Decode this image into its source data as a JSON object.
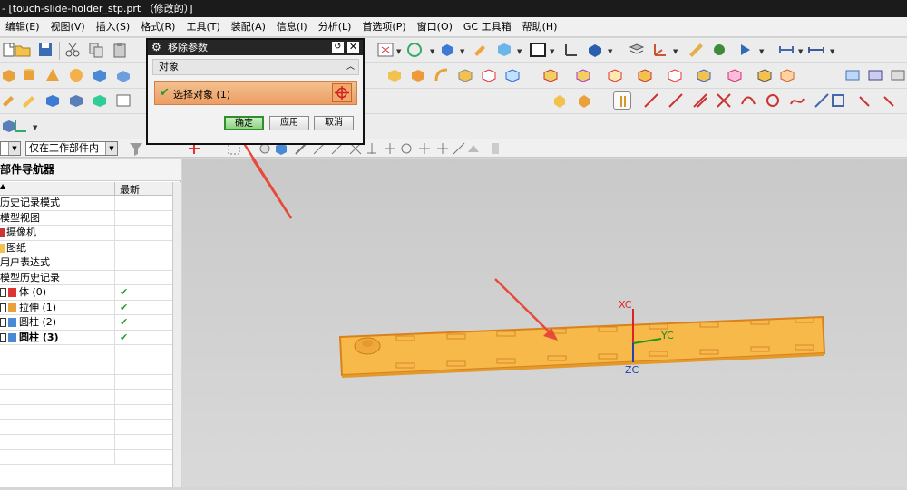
{
  "window": {
    "title": "- [touch-slide-holder_stp.prt （修改的）]"
  },
  "menu": [
    "编辑(E)",
    "视图(V)",
    "插入(S)",
    "格式(R)",
    "工具(T)",
    "装配(A)",
    "信息(I)",
    "分析(L)",
    "首选项(P)",
    "窗口(O)",
    "GC 工具箱",
    "帮助(H)"
  ],
  "filter": {
    "selection_filter": "",
    "scope": "仅在工作部件内"
  },
  "navigator": {
    "title": "部件导航器",
    "col_name": "",
    "col_latest": "最新",
    "rows": [
      {
        "label": "历史记录模式",
        "latest": ""
      },
      {
        "label": "模型视图",
        "latest": ""
      },
      {
        "label": "摄像机",
        "latest": ""
      },
      {
        "label": "图纸",
        "latest": ""
      },
      {
        "label": "用户表达式",
        "latest": ""
      },
      {
        "label": "模型历史记录",
        "latest": ""
      },
      {
        "label": "体 (0)",
        "latest": "✔"
      },
      {
        "label": "拉伸 (1)",
        "latest": "✔"
      },
      {
        "label": "圆柱 (2)",
        "latest": "✔"
      },
      {
        "label": "圆柱 (3)",
        "latest": "✔"
      }
    ]
  },
  "dialog": {
    "title": "移除参数",
    "section": "对象",
    "select_label": "选择对象 (1)",
    "ok": "确定",
    "apply": "应用",
    "cancel": "取消"
  },
  "viewport": {
    "axis_x": "XC",
    "axis_y": "YC",
    "axis_z": "ZC"
  },
  "colors": {
    "part": "#f7b94a",
    "part_edge": "#d9821b",
    "arrow": "#e84a3a",
    "check": "#2a9a2a"
  }
}
